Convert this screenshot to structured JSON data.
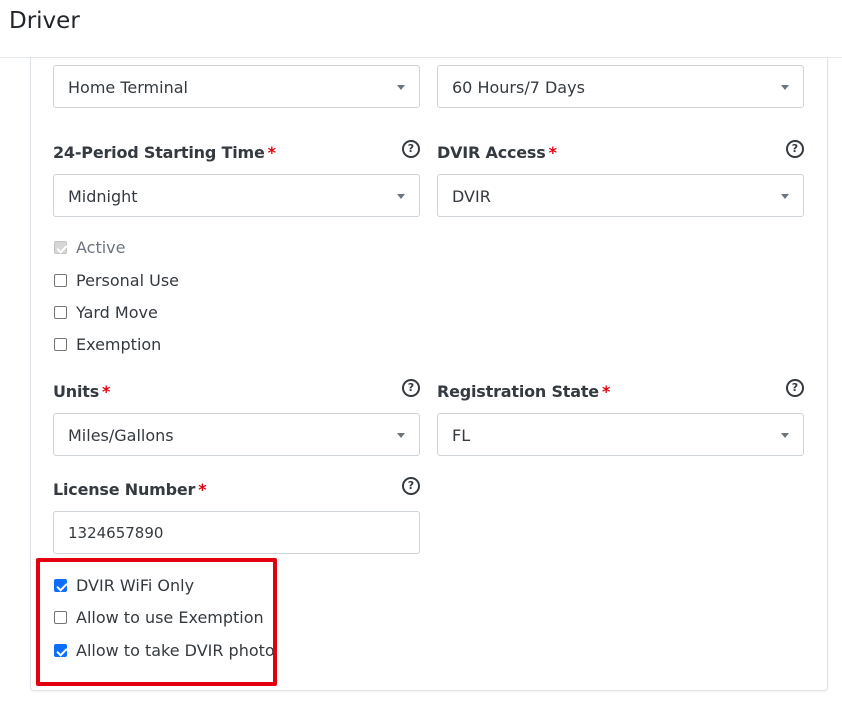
{
  "header": {
    "title": "Driver"
  },
  "fields": {
    "home_terminal": {
      "value": "Home Terminal"
    },
    "cycle": {
      "value": "60 Hours/7 Days"
    },
    "period_start": {
      "label": "24-Period Starting Time",
      "required": "*",
      "help": "?",
      "value": "Midnight"
    },
    "dvir_access": {
      "label": "DVIR Access",
      "required": "*",
      "help": "?",
      "value": "DVIR"
    },
    "units": {
      "label": "Units",
      "required": "*",
      "help": "?",
      "value": "Miles/Gallons"
    },
    "registration_state": {
      "label": "Registration State",
      "required": "*",
      "help": "?",
      "value": "FL"
    },
    "license_number": {
      "label": "License Number",
      "required": "*",
      "help": "?",
      "value": "1324657890"
    }
  },
  "status_checkboxes": [
    {
      "label": "Active",
      "checked": true,
      "disabled": true
    },
    {
      "label": "Personal Use",
      "checked": false
    },
    {
      "label": "Yard Move",
      "checked": false
    },
    {
      "label": "Exemption",
      "checked": false
    }
  ],
  "option_checkboxes": [
    {
      "label": "DVIR WiFi Only",
      "checked": true
    },
    {
      "label": "Allow to use Exemption",
      "checked": false
    },
    {
      "label": "Allow to take DVIR photo",
      "checked": true
    }
  ],
  "colors": {
    "accent": "#0d6efd",
    "required": "#e3000f",
    "highlight": "#e3000f"
  }
}
